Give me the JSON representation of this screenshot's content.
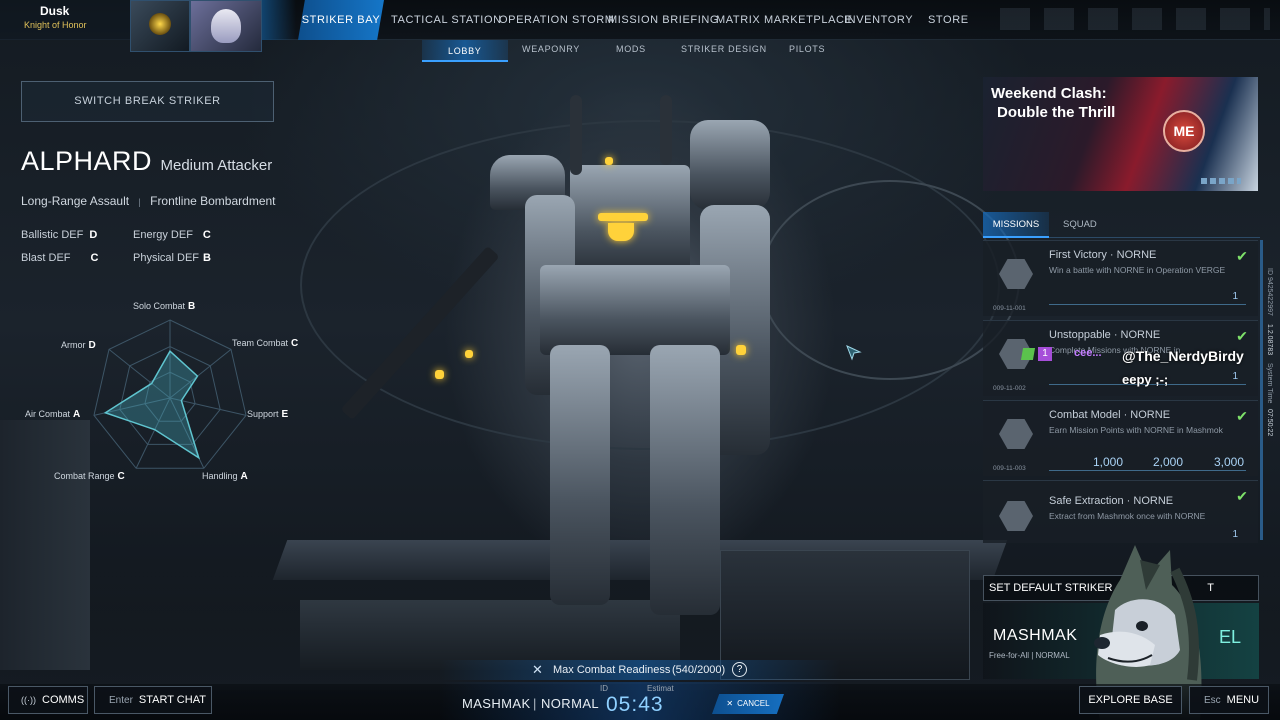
{
  "player": {
    "name": "Dusk",
    "title": "Knight of Honor"
  },
  "nav": {
    "items": [
      "STRIKER BAY",
      "TACTICAL STATION",
      "OPERATION STORM",
      "MISSION BRIEFING",
      "MATRIX MARKETPLACE",
      "INVENTORY",
      "STORE"
    ],
    "active": "STRIKER BAY"
  },
  "subnav": {
    "items": [
      "LOBBY",
      "WEAPONRY",
      "MODS",
      "STRIKER DESIGN",
      "PILOTS"
    ],
    "active": "LOBBY"
  },
  "left_panel": {
    "switch_button": "SWITCH BREAK STRIKER",
    "striker_name": "ALPHARD",
    "striker_class": "Medium Attacker",
    "roles": [
      "Long-Range Assault",
      "Frontline Bombardment"
    ],
    "defenses": [
      {
        "label": "Ballistic DEF",
        "grade": "D"
      },
      {
        "label": "Energy DEF",
        "grade": "C"
      },
      {
        "label": "Blast DEF",
        "grade": "C"
      },
      {
        "label": "Physical DEF",
        "grade": "B"
      }
    ],
    "radar": [
      {
        "label": "Solo Combat",
        "grade": "B",
        "value": 0.6
      },
      {
        "label": "Team Combat",
        "grade": "C",
        "value": 0.45
      },
      {
        "label": "Support",
        "grade": "E",
        "value": 0.15
      },
      {
        "label": "Handling",
        "grade": "A",
        "value": 0.85
      },
      {
        "label": "Combat Range",
        "grade": "C",
        "value": 0.45
      },
      {
        "label": "Air Combat",
        "grade": "A",
        "value": 0.85
      },
      {
        "label": "Armor",
        "grade": "D",
        "value": 0.3
      }
    ]
  },
  "banner": {
    "title_line1": "Weekend Clash:",
    "title_line2": "Double the Thrill",
    "emblem": "ME"
  },
  "right_tabs": {
    "items": [
      "MISSIONS",
      "SQUAD"
    ],
    "active": "MISSIONS"
  },
  "missions": [
    {
      "title": "First Victory · NORNE",
      "desc": "Win a battle with NORNE in Operation VERGE",
      "code": "009-11-001",
      "count": "1"
    },
    {
      "title": "Unstoppable · NORNE",
      "desc": "Complete Missions with NORNE in",
      "code": "009-11-002",
      "count": "1"
    },
    {
      "title": "Combat Model · NORNE",
      "desc": "Earn Mission Points with NORNE in Mashmok",
      "code": "009-11-003",
      "milestones": [
        "1,000",
        "2,000",
        "3,000"
      ]
    },
    {
      "title": "Safe Extraction · NORNE",
      "desc": "Extract from Mashmok once with NORNE",
      "code": "",
      "count": "1"
    }
  ],
  "side_info": {
    "id_text": "ID 9425422997",
    "version": "1.2.08783",
    "system_time_label": "System Time",
    "system_time": "07:50:22"
  },
  "chat_overlay": {
    "user": "@The_NerdyBirdy",
    "message": "eepy ;-;",
    "badge_text": "1",
    "name_fragment": "cee..."
  },
  "set_default": {
    "label": "SET DEFAULT STRIKER",
    "trailing": "T"
  },
  "match_card": {
    "map": "MASHMAK",
    "mode": "Free-for-All | NORMAL",
    "trailing": "EL"
  },
  "readiness": {
    "label": "Max Combat Readiness",
    "current": 540,
    "max": 2000,
    "text": "(540/2000)"
  },
  "queue": {
    "map": "MASHMAK",
    "mode": "NORMAL",
    "id_label": "ID",
    "estimate_label": "Estimat",
    "timer": "05:43",
    "cancel": "CANCEL"
  },
  "bottom": {
    "comms": "COMMS",
    "chat_key": "Enter",
    "chat_label": "START CHAT",
    "explore": "EXPLORE BASE",
    "menu_key": "Esc",
    "menu_label": "MENU"
  }
}
